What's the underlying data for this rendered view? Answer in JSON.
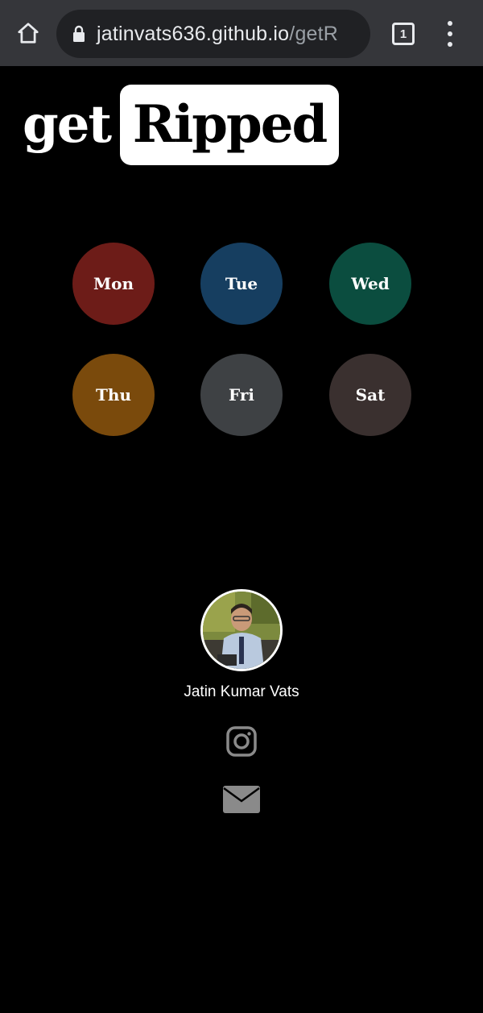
{
  "browser": {
    "url_domain": "jatinvats636.github.io",
    "url_path": "/getR",
    "tab_count": "1",
    "icons": {
      "home": "home-icon",
      "lock": "lock-icon",
      "tabs": "tab-switcher-icon",
      "menu": "more-vert-icon"
    }
  },
  "logo": {
    "part1": "get",
    "part2": "Ripped"
  },
  "days": [
    {
      "label": "Mon",
      "color": "#6d1c18"
    },
    {
      "label": "Tue",
      "color": "#163e60"
    },
    {
      "label": "Wed",
      "color": "#0b4d3f"
    },
    {
      "label": "Thu",
      "color": "#7a4a0c"
    },
    {
      "label": "Fri",
      "color": "#3e4144"
    },
    {
      "label": "Sat",
      "color": "#3a302f"
    }
  ],
  "footer": {
    "author_name": "Jatin Kumar Vats",
    "icons": {
      "instagram": "instagram-icon",
      "email": "mail-icon"
    }
  },
  "colors": {
    "background": "#000000",
    "toolbar": "#35363a",
    "omnibox": "#202124",
    "icon_gray": "#8a8a8a"
  }
}
